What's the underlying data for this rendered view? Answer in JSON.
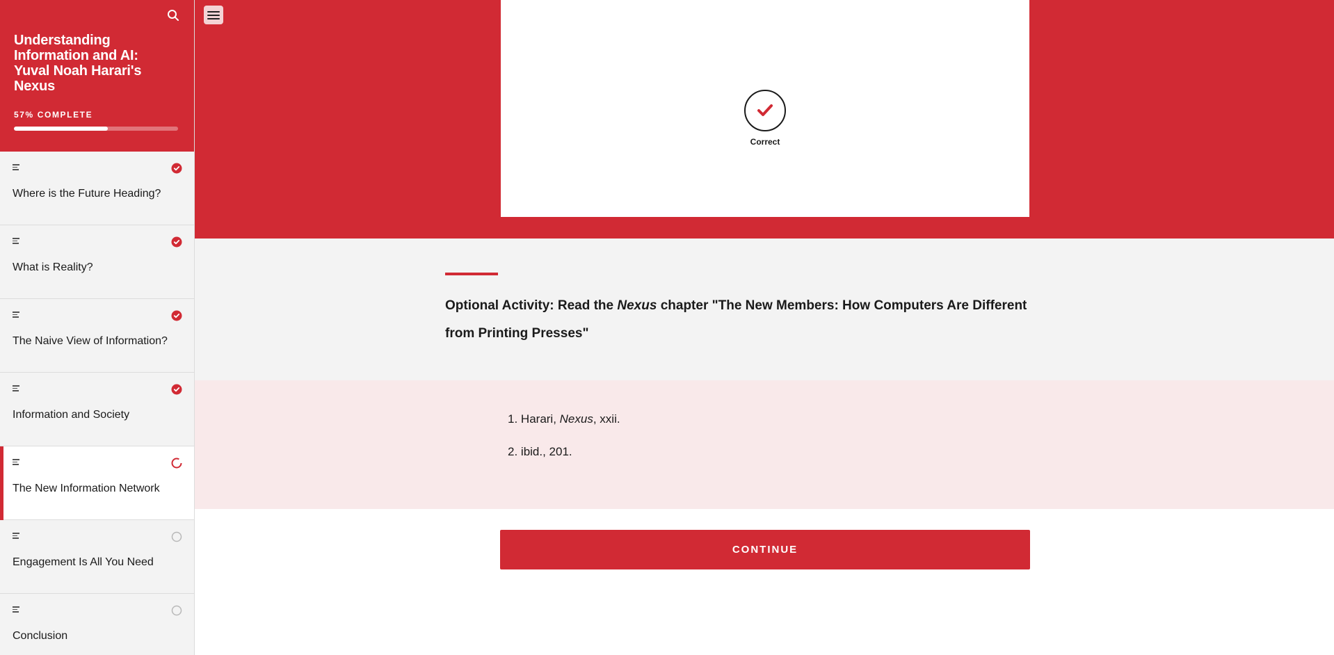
{
  "sidebar": {
    "course_title": "Understanding Information and AI: Yuval Noah Harari's Nexus",
    "progress_label": "57% COMPLETE",
    "progress_percent": 57,
    "lessons": [
      {
        "label": "Where is the Future Heading?",
        "status": "complete"
      },
      {
        "label": "What is Reality?",
        "status": "complete"
      },
      {
        "label": "The Naive View of Information?",
        "status": "complete"
      },
      {
        "label": "Information and Society",
        "status": "complete"
      },
      {
        "label": "The New Information Network",
        "status": "in-progress"
      },
      {
        "label": "Engagement Is All You Need",
        "status": "not-started"
      },
      {
        "label": "Conclusion",
        "status": "not-started"
      }
    ]
  },
  "main": {
    "quiz_feedback": "Correct",
    "activity": {
      "prefix": "Optional Activity: Read the ",
      "italic": "Nexus",
      "suffix": " chapter \"The New Members: How Computers Are Different from Printing Presses\""
    },
    "footnotes": [
      {
        "number": "1.",
        "pre": "Harari, ",
        "italic": "Nexus",
        "post": ", xxii."
      },
      {
        "number": "2.",
        "pre": "ibid., 201.",
        "italic": "",
        "post": ""
      }
    ],
    "continue_label": "CONTINUE"
  },
  "colors": {
    "accent": "#d12a34",
    "sidebar_bg": "#f3f3f3",
    "footnote_bg": "#f9e9ea"
  },
  "icons": {
    "search": "search-icon",
    "menu": "hamburger-menu-icon",
    "lesson_type": "text-lines-icon",
    "complete": "check-circle-icon",
    "in_progress": "progress-ring-icon",
    "not_started": "empty-circle-icon",
    "correct": "checkmark-icon"
  }
}
